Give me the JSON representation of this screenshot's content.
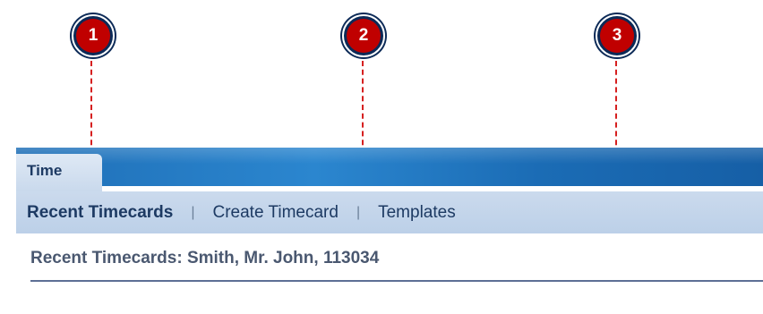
{
  "callouts": [
    "1",
    "2",
    "3"
  ],
  "tabs": [
    {
      "label": "Time",
      "active": true
    }
  ],
  "subnav": {
    "active_label": "Recent Timecards",
    "separator": "|",
    "items": [
      "Create Timecard",
      "Templates"
    ]
  },
  "page": {
    "heading": "Recent Timecards: Smith, Mr. John, 113034"
  },
  "colors": {
    "banner": "#1f6fb7",
    "tab": "#d5e2f1",
    "subnav": "#c3d5eb",
    "callout_fill": "#c00000",
    "callout_ring": "#0c2a57",
    "leader_line": "#d62020"
  }
}
